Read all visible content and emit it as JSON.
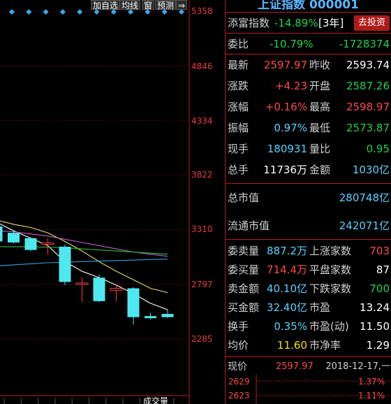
{
  "toolbar": {
    "watchlist": "加自选",
    "ma": "均线",
    "window": "窗",
    "forecast": "预测",
    "arrow": "⇒"
  },
  "price_axis": [
    "5358",
    "4846",
    "4334",
    "3822",
    "3310",
    "2797",
    "2285"
  ],
  "volume_label": "成交量",
  "chart_data": {
    "type": "candlestick",
    "y_range": [
      2285,
      5358
    ],
    "candles": [
      {
        "open": 3200,
        "close": 3340,
        "high": 3420,
        "low": 3110,
        "color": "cyan"
      },
      {
        "open": 3280,
        "close": 3190,
        "high": 3300,
        "low": 3180,
        "color": "cyan"
      },
      {
        "open": 3230,
        "close": 3120,
        "high": 3240,
        "low": 3110,
        "color": "cyan"
      },
      {
        "open": 3185,
        "close": 3180,
        "high": 3230,
        "low": 3080,
        "color": "red"
      },
      {
        "open": 3150,
        "close": 2820,
        "high": 3170,
        "low": 2790,
        "color": "cyan"
      },
      {
        "open": 2800,
        "close": 2810,
        "high": 2860,
        "low": 2630,
        "color": "red"
      },
      {
        "open": 2860,
        "close": 2640,
        "high": 2890,
        "low": 2630,
        "color": "cyan"
      },
      {
        "open": 2740,
        "close": 2760,
        "high": 2800,
        "low": 2640,
        "color": "red"
      },
      {
        "open": 2760,
        "close": 2490,
        "high": 2770,
        "low": 2420,
        "color": "cyan"
      },
      {
        "open": 2500,
        "close": 2480,
        "high": 2530,
        "low": 2470,
        "color": "cyan"
      },
      {
        "open": 2520,
        "close": 2490,
        "high": 2560,
        "low": 2480,
        "color": "cyan"
      }
    ],
    "ma_lines": [
      {
        "color": "#ffffff",
        "values": [
          3380,
          3300,
          3230,
          3160,
          3010,
          2920,
          2860,
          2790,
          2710,
          2620,
          2560
        ]
      },
      {
        "color": "#e8e060",
        "values": [
          3400,
          3360,
          3330,
          3280,
          3200,
          3110,
          3010,
          2920,
          2840,
          2760,
          2720
        ]
      },
      {
        "color": "#c060d0",
        "values": [
          3300,
          3290,
          3270,
          3250,
          3220,
          3190,
          3160,
          3130,
          3100,
          3080,
          3060
        ]
      },
      {
        "color": "#30c030",
        "values": [
          3150,
          3150,
          3150,
          3145,
          3140,
          3130,
          3120,
          3110,
          3100,
          3090,
          3080
        ]
      },
      {
        "color": "#30a0e0",
        "values": [
          2970,
          2980,
          2990,
          3000,
          3005,
          3010,
          3015,
          3020,
          3025,
          3030,
          3035
        ]
      }
    ]
  },
  "quote": {
    "title": "上证指数 000001",
    "tianfu_label": "添富指数",
    "tianfu_value": "-14.89%",
    "tianfu_period": "[3年]",
    "invest_button": "去投资",
    "weibi_label": "委比",
    "weibi_pct": "-10.79%",
    "weibi_val": "-1728374",
    "rows": [
      {
        "l1": "最新",
        "v1": "2597.97",
        "c1": "red",
        "l2": "昨收",
        "v2": "2593.74",
        "c2": "white"
      },
      {
        "l1": "涨跌",
        "v1": "+4.23",
        "c1": "red",
        "l2": "开盘",
        "v2": "2587.26",
        "c2": "green"
      },
      {
        "l1": "涨幅",
        "v1": "+0.16%",
        "c1": "red",
        "l2": "最高",
        "v2": "2598.97",
        "c2": "red"
      },
      {
        "l1": "振幅",
        "v1": "0.97%",
        "c1": "cyan",
        "l2": "最低",
        "v2": "2573.87",
        "c2": "green"
      },
      {
        "l1": "现手",
        "v1": "180931",
        "c1": "cyan",
        "l2": "量比",
        "v2": "0.95",
        "c2": "green"
      },
      {
        "l1": "总手",
        "v1": "11736万",
        "c1": "white",
        "l2": "金额",
        "v2": "1030亿",
        "c2": "cyan"
      }
    ],
    "total_mv_label": "总市值",
    "total_mv_value": "280748亿",
    "float_mv_label": "流通市值",
    "float_mv_value": "242071亿",
    "rows2": [
      {
        "l1": "委卖量",
        "v1": "887.2万",
        "c1": "cyan",
        "l2": "上涨家数",
        "v2": "703",
        "c2": "red"
      },
      {
        "l1": "委买量",
        "v1": "714.4万",
        "c1": "red",
        "l2": "平盘家数",
        "v2": "87",
        "c2": "white"
      },
      {
        "l1": "卖金额",
        "v1": "40.10亿",
        "c1": "cyan",
        "l2": "下跌家数",
        "v2": "700",
        "c2": "green"
      },
      {
        "l1": "买金额",
        "v1": "32.40亿",
        "c1": "cyan",
        "l2": "市盈",
        "v2": "13.24",
        "c2": "white"
      },
      {
        "l1": "换手",
        "v1": "0.35%",
        "c1": "cyan",
        "l2": "市盈(动)",
        "v2": "11.50",
        "c2": "white"
      },
      {
        "l1": "均价",
        "v1": "11.60",
        "c1": "yellow",
        "l2": "市净率",
        "v2": "1.29",
        "c2": "white"
      }
    ],
    "now_price_label": "现价",
    "now_price_value": "2597.97",
    "date": "2018-12-17,一",
    "mini": {
      "p1": "2629",
      "pct1": "1.37%",
      "p2": "2623",
      "pct2": "1.11%"
    }
  }
}
